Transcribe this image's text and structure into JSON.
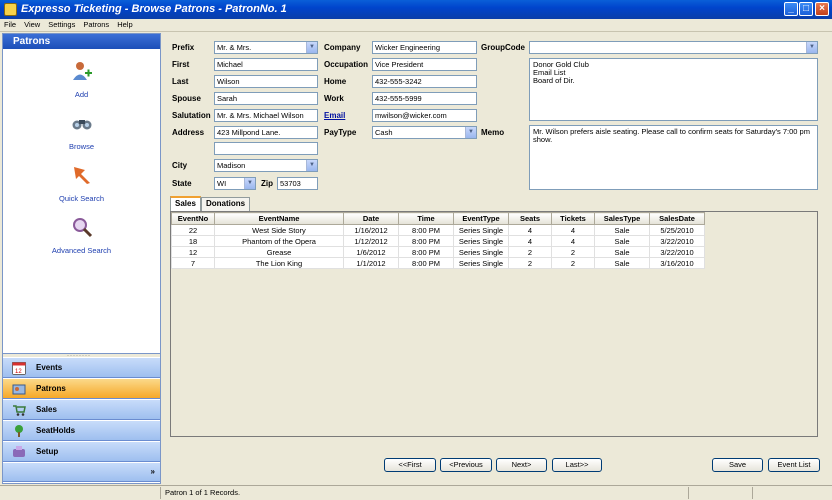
{
  "window": {
    "title": "Expresso Ticketing - Browse Patrons - PatronNo. 1"
  },
  "menu": [
    "File",
    "View",
    "Settings",
    "Patrons",
    "Help"
  ],
  "nav": {
    "header": "Patrons",
    "items": [
      {
        "label": "Add",
        "icon": "add-user-icon"
      },
      {
        "label": "Browse",
        "icon": "binoculars-icon"
      },
      {
        "label": "Quick Search",
        "icon": "quick-search-icon"
      },
      {
        "label": "Advanced Search",
        "icon": "magnifier-icon"
      }
    ],
    "groups": [
      {
        "label": "Events",
        "icon": "calendar-icon",
        "active": false
      },
      {
        "label": "Patrons",
        "icon": "patrons-icon",
        "active": true
      },
      {
        "label": "Sales",
        "icon": "cart-icon",
        "active": false
      },
      {
        "label": "SeatHolds",
        "icon": "seat-icon",
        "active": false
      },
      {
        "label": "Setup",
        "icon": "setup-icon",
        "active": false
      }
    ],
    "more": "»"
  },
  "form": {
    "labels": {
      "prefix": "Prefix",
      "first": "First",
      "last": "Last",
      "spouse": "Spouse",
      "salutation": "Salutation",
      "address": "Address",
      "city": "City",
      "state": "State",
      "zip": "Zip",
      "company": "Company",
      "occupation": "Occupation",
      "home": "Home",
      "work": "Work",
      "email": "Email",
      "paytype": "PayType",
      "groupcode": "GroupCode",
      "memo": "Memo"
    },
    "values": {
      "prefix": "Mr. & Mrs.",
      "first": "Michael",
      "last": "Wilson",
      "spouse": "Sarah",
      "salutation": "Mr. & Mrs. Michael Wilson",
      "address1": "423 Millpond Lane.",
      "address2": "",
      "city": "Madison",
      "state": "WI",
      "zip": "53703",
      "company": "Wicker Engineering",
      "occupation": "Vice President",
      "home": "432-555-3242",
      "work": "432-555-5999",
      "email": "mwilson@wicker.com",
      "paytype": "Cash",
      "groupcode": "",
      "groups_list": "Donor Gold Club\nEmail List\nBoard of Dir.",
      "memo": "Mr. Wilson prefers aisle seating. Please call to confirm seats for Saturday's 7:00 pm show."
    }
  },
  "tabs": [
    "Sales",
    "Donations"
  ],
  "sales_table": {
    "columns": [
      "EventNo",
      "EventName",
      "Date",
      "Time",
      "EventType",
      "Seats",
      "Tickets",
      "SalesType",
      "SalesDate"
    ],
    "rows": [
      [
        "22",
        "West Side Story",
        "1/16/2012",
        "8:00 PM",
        "Series Single",
        "4",
        "4",
        "Sale",
        "5/25/2010"
      ],
      [
        "18",
        "Phantom of the Opera",
        "1/12/2012",
        "8:00 PM",
        "Series Single",
        "4",
        "4",
        "Sale",
        "3/22/2010"
      ],
      [
        "12",
        "Grease",
        "1/6/2012",
        "8:00 PM",
        "Series Single",
        "2",
        "2",
        "Sale",
        "3/22/2010"
      ],
      [
        "7",
        "The Lion King",
        "1/1/2012",
        "8:00 PM",
        "Series Single",
        "2",
        "2",
        "Sale",
        "3/16/2010"
      ]
    ]
  },
  "buttons": {
    "first": "<<First",
    "previous": "<Previous",
    "next": "Next>",
    "last": "Last>>",
    "save": "Save",
    "event_list": "Event List"
  },
  "status": {
    "text": "Patron 1 of 1 Records."
  },
  "colors": {
    "titlebar": "#0044cc",
    "nav_header": "#1c4fb8",
    "active_group": "#f6a828"
  }
}
